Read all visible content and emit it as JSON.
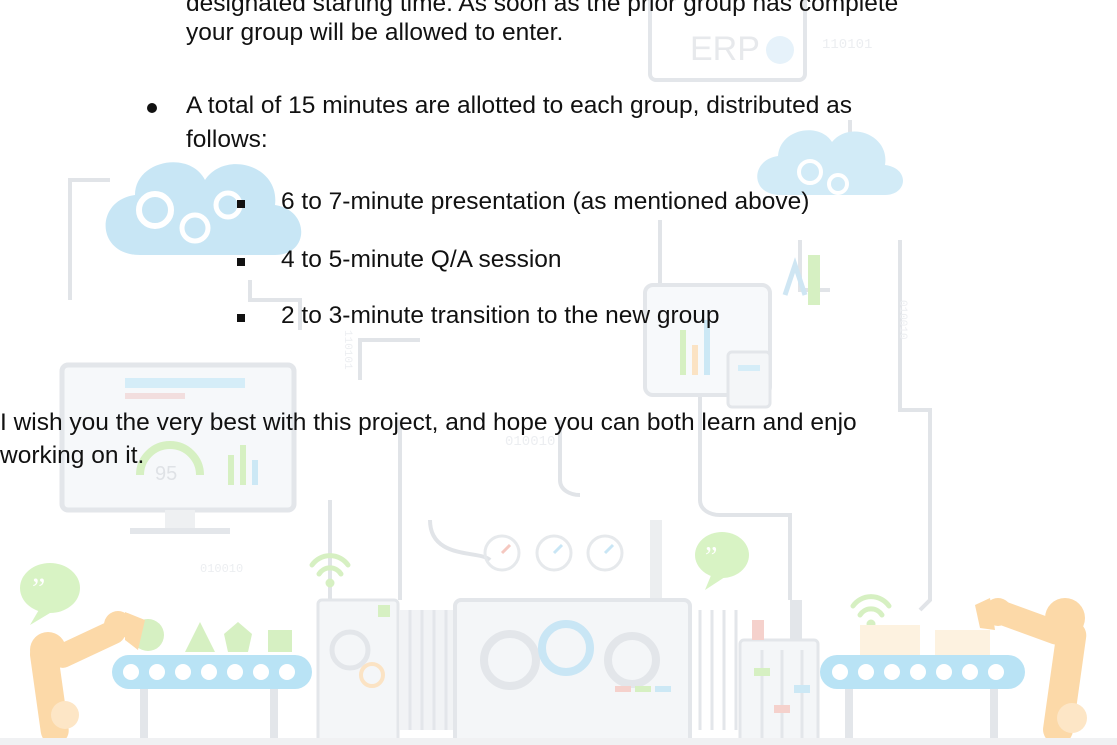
{
  "document": {
    "top_bullet_tail": {
      "line1": "designated starting time. As soon as the prior group has complete",
      "line2": "your group will be allowed to enter."
    },
    "time_bullet": {
      "line1": "A total of 15 minutes are allotted to each group, distributed as",
      "line2": "follows:"
    },
    "sub_items": [
      "6 to 7-minute presentation (as mentioned above)",
      "4 to 5-minute Q/A session",
      "2 to 3-minute transition to the new group"
    ],
    "closing": {
      "line1": "I wish you the very best with this project, and hope you can both learn and enjo",
      "line2": "working on it."
    }
  },
  "watermark": {
    "labels": [
      "ERP",
      "110101",
      "010010",
      "010010",
      "110101",
      "010010",
      "010010"
    ],
    "gauge_value": "95"
  },
  "colors": {
    "gear_cloud": "#c8e6f5",
    "robot_arm": "#fcd9a8",
    "conveyor": "#b9e3f5",
    "accent_green": "#c8f0b4",
    "line_grey": "#dadde2"
  }
}
